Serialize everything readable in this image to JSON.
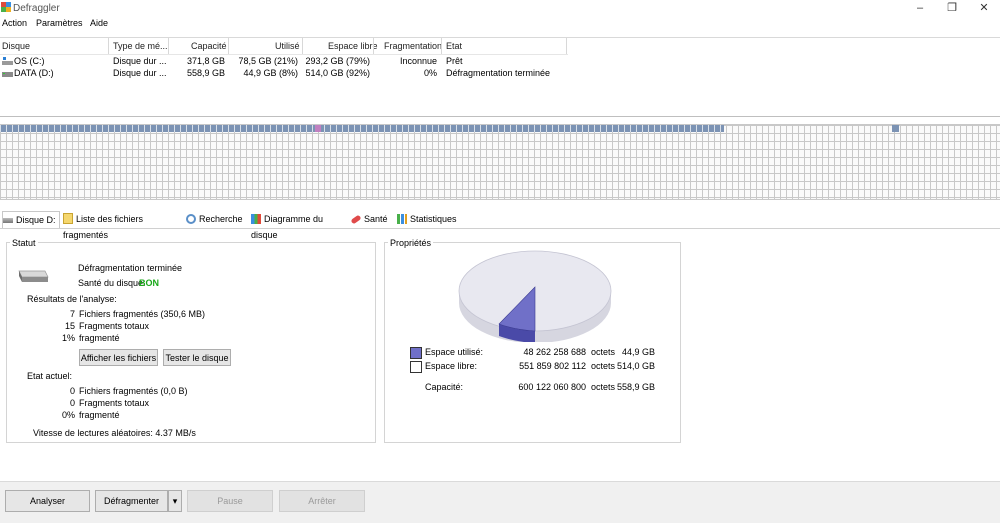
{
  "window": {
    "title": "Defraggler"
  },
  "menu": [
    "Action",
    "Paramètres",
    "Aide"
  ],
  "disk_list": {
    "columns": [
      "Disque",
      "Type de mé...",
      "Capacité",
      "Utilisé",
      "Espace libre",
      "Fragmentation",
      "Etat"
    ],
    "rows": [
      {
        "disque": "OS (C:)",
        "type": "Disque dur ...",
        "capacite": "371,8 GB",
        "utilise": "78,5 GB (21%)",
        "libre": "293,2 GB (79%)",
        "fragmentation": "Inconnue",
        "etat": "Prêt"
      },
      {
        "disque": "DATA (D:)",
        "type": "Disque dur ...",
        "capacite": "558,9 GB",
        "utilise": "44,9 GB (8%)",
        "libre": "514,0 GB (92%)",
        "fragmentation": "0%",
        "etat": "Défragmentation terminée"
      }
    ]
  },
  "tabs": [
    "Disque D:",
    "Liste des fichiers fragmentés",
    "Recherche",
    "Diagramme du disque",
    "Santé",
    "Statistiques"
  ],
  "statut": {
    "title": "Statut",
    "message": "Défragmentation terminée",
    "health_label": "Santé du disque:",
    "health_value": "BON",
    "analysis_title": "Résultats de l'analyse:",
    "analysis": [
      {
        "value": "7",
        "label": "Fichiers fragmentés (350,6 MB)"
      },
      {
        "value": "15",
        "label": "Fragments totaux"
      },
      {
        "value": "1%",
        "label": "fragmenté"
      }
    ],
    "btn_show_files": "Afficher les fichiers",
    "btn_test_disk": "Tester le disque",
    "current_title": "Etat actuel:",
    "current": [
      {
        "value": "0",
        "label": "Fichiers fragmentés (0,0 B)"
      },
      {
        "value": "0",
        "label": "Fragments totaux"
      },
      {
        "value": "0%",
        "label": "fragmenté"
      }
    ],
    "read_speed": "Vitesse de lectures aléatoires: 4.37 MB/s"
  },
  "proprietes": {
    "title": "Propriétés",
    "used": {
      "label": "Espace utilisé:",
      "bytes": "48 262 258 688",
      "unit": "octets",
      "gb": "44,9 GB"
    },
    "free": {
      "label": "Espace libre:",
      "bytes": "551 859 802 112",
      "unit": "octets",
      "gb": "514,0 GB"
    },
    "capacity": {
      "label": "Capacité:",
      "bytes": "600 122 060 800",
      "unit": "octets",
      "gb": "558,9 GB"
    },
    "used_fraction": 0.08,
    "colors": {
      "used": "#7070c8",
      "free": "#e8e8f0"
    }
  },
  "buttons": {
    "analyser": "Analyser",
    "defragmenter": "Défragmenter",
    "pause": "Pause",
    "arreter": "Arrêter"
  }
}
